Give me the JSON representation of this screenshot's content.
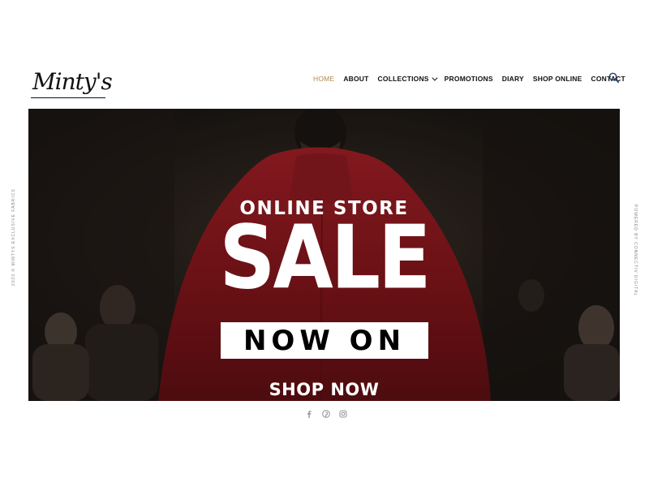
{
  "brand": {
    "logo_text": "Minty's"
  },
  "nav": {
    "items": [
      {
        "label": "HOME",
        "active": true
      },
      {
        "label": "ABOUT"
      },
      {
        "label": "COLLECTIONS",
        "dropdown": true
      },
      {
        "label": "PROMOTIONS"
      },
      {
        "label": "DIARY"
      },
      {
        "label": "SHOP ONLINE"
      },
      {
        "label": "CONTACT"
      }
    ],
    "search_icon": "search-icon"
  },
  "hero": {
    "eyebrow": "ONLINE STORE",
    "headline": "SALE",
    "badge": "NOW ON",
    "cta": "SHOP NOW"
  },
  "social": {
    "icons": [
      "facebook-icon",
      "pinterest-icon",
      "instagram-icon"
    ]
  },
  "side": {
    "left": "2020 © MINTYS EXCLUSIVE FABRICS",
    "right": "POWERED BY CONNECTIV DIGITAL"
  },
  "colors": {
    "accent": "#b08a4e",
    "hero_red": "#8a1a1f",
    "text": "#111111"
  }
}
